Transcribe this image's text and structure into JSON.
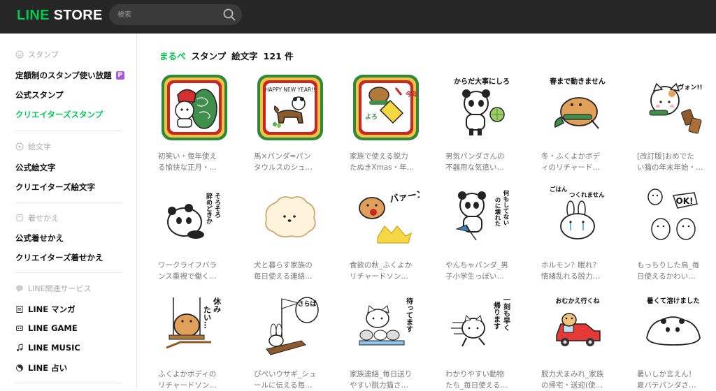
{
  "header": {
    "logo_prefix": "LINE",
    "logo_suffix": " STORE",
    "search_placeholder": "検索"
  },
  "sidebar": {
    "sec_stamp": "スタンプ",
    "stamp_items": [
      "定額制のスタンプ使い放題",
      "公式スタンプ",
      "クリエイターズスタンプ"
    ],
    "sec_emoji": "絵文字",
    "emoji_items": [
      "公式絵文字",
      "クリエイターズ絵文字"
    ],
    "sec_theme": "着せかえ",
    "theme_items": [
      "公式着せかえ",
      "クリエイターズ着せかえ"
    ],
    "sec_services": "LINE関連サービス",
    "service_items": [
      "LINE マンガ",
      "LINE GAME",
      "LINE MUSIC",
      "LINE 占い"
    ],
    "premium_badge": "P"
  },
  "main": {
    "search_term": "まるぺ",
    "tab_stamp": "スタンプ",
    "tab_emoji": "絵文字",
    "count": "121 件"
  },
  "items": [
    {
      "line1": "初笑い・毎年使え",
      "line2": "る愉快な正月・…",
      "icon": "lion-dance-panda-sticker"
    },
    {
      "line1": "馬×パンダ=パン",
      "line2": "タウルスのシュ…",
      "icon": "happy-new-year-panda-sticker",
      "art_text": "HAPPY NEW YEAR!!"
    },
    {
      "line1": "家族で使える脱力",
      "line2": "たぬきXmas・年…",
      "icon": "tanuki-new-year-sticker",
      "art_text": "今年もよろしくね"
    },
    {
      "line1": "男気パンダさんの",
      "line2": "不器用な気遣い…",
      "icon": "panda-melon-sticker",
      "art_text": "からだ大事にしろ"
    },
    {
      "line1": "冬・ふくよかボデ",
      "line2": "ィのリチャード…",
      "icon": "winter-hamster-sticker",
      "art_text": "春まで動きません"
    },
    {
      "line1": "[改訂版]おめでた",
      "line2": "い猫の年末年始・…",
      "icon": "cat-celebration-sticker",
      "art_text": "ヴォン!!"
    },
    {
      "line1": "ワークライフバラ",
      "line2": "ンス重視で働く…",
      "icon": "panda-lying-sticker",
      "art_text": "そろそろ辞めどきか"
    },
    {
      "line1": "犬と暮らす家族の",
      "line2": "毎日使える連絡…",
      "icon": "fluffy-dog-sticker"
    },
    {
      "line1": "食欲の秋_ふくよか",
      "line2": "リチャードソン…",
      "icon": "hamster-eating-sticker",
      "art_text": "バァーン"
    },
    {
      "line1": "やんちゃパンダ_男",
      "line2": "子小学生っぽい…",
      "icon": "panda-umbrella-sticker",
      "art_text": "何もしてないのに壊れた"
    },
    {
      "line1": "ホルモン？眠れ？",
      "line2": "情緒乱れる脱力…",
      "icon": "rabbit-crying-sticker",
      "art_text": "ごはんつくれません"
    },
    {
      "line1": "もっちりした鳥_毎",
      "line2": "日使えるかわい…",
      "icon": "birds-ok-sticker",
      "art_text": "OK!"
    },
    {
      "line1": "ふくよかボディの",
      "line2": "リチャードソン…",
      "icon": "hamster-swing-sticker",
      "art_text": "休みたい…"
    },
    {
      "line1": "ぴべいウサギ_シュ",
      "line2": "ールに伝える毎…",
      "icon": "rabbit-flag-sticker",
      "art_text": "さらば"
    },
    {
      "line1": "家族連絡_毎日送り",
      "line2": "やすい脱力猫さ…",
      "icon": "cats-waiting-sticker",
      "art_text": "待ってます"
    },
    {
      "line1": "わかりやすい動物",
      "line2": "たち_毎日使える…",
      "icon": "cat-running-sticker",
      "art_text": "一刻も早く帰ります"
    },
    {
      "line1": "脱力犬まみれ_家族",
      "line2": "の帰宅・送迎(使…",
      "icon": "dog-car-sticker",
      "art_text": "おむかえ行くね"
    },
    {
      "line1": "暑いしか言えん！",
      "line2": "夏バテパンダさ…",
      "icon": "melting-panda-sticker",
      "art_text": "暑くて溶けました"
    }
  ],
  "colors": {
    "accent": "#06c755",
    "topbar": "#262626",
    "premium": "#a35ee0"
  }
}
